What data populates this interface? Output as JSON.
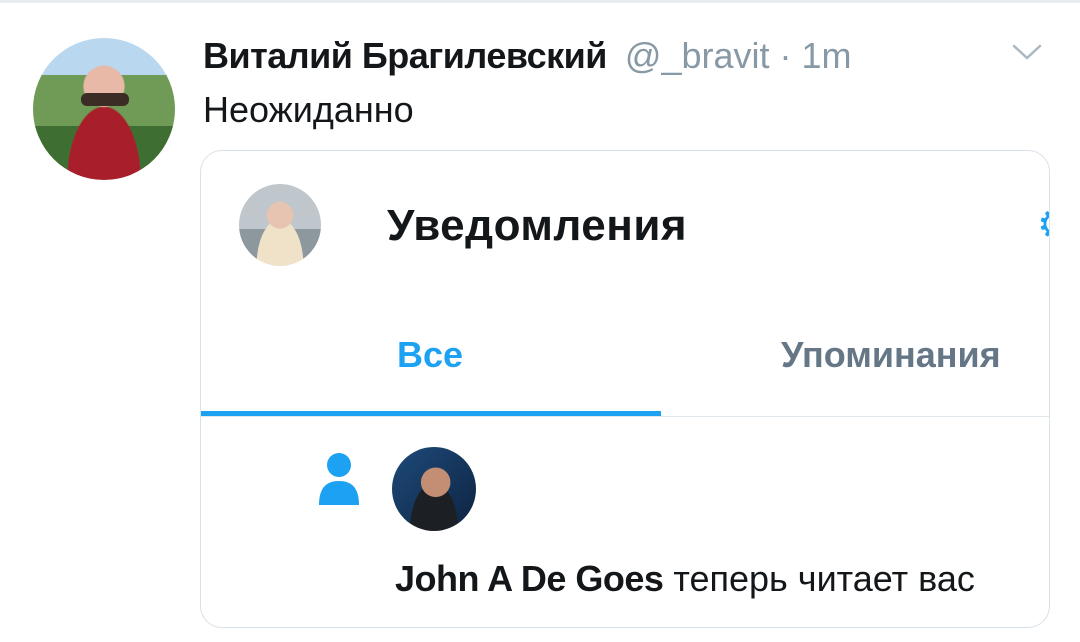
{
  "tweet": {
    "author_name": "Виталий Брагилевский",
    "meta": "@_bravit · 1m",
    "text": "Неожиданно"
  },
  "card": {
    "title": "Уведомления",
    "tabs": [
      {
        "label": "Все",
        "active": true
      },
      {
        "label": "Упоминания",
        "active": false
      }
    ],
    "notification": {
      "user_name": "John A De Goes",
      "action_text": "теперь читает вас"
    }
  },
  "icons": {
    "menu_caret": "chevron-down-icon",
    "settings": "gear-icon",
    "follow": "person-icon"
  },
  "colors": {
    "accent": "#1da1f2",
    "text_primary": "#14171a",
    "text_secondary": "#657786",
    "meta": "#8899a6"
  }
}
